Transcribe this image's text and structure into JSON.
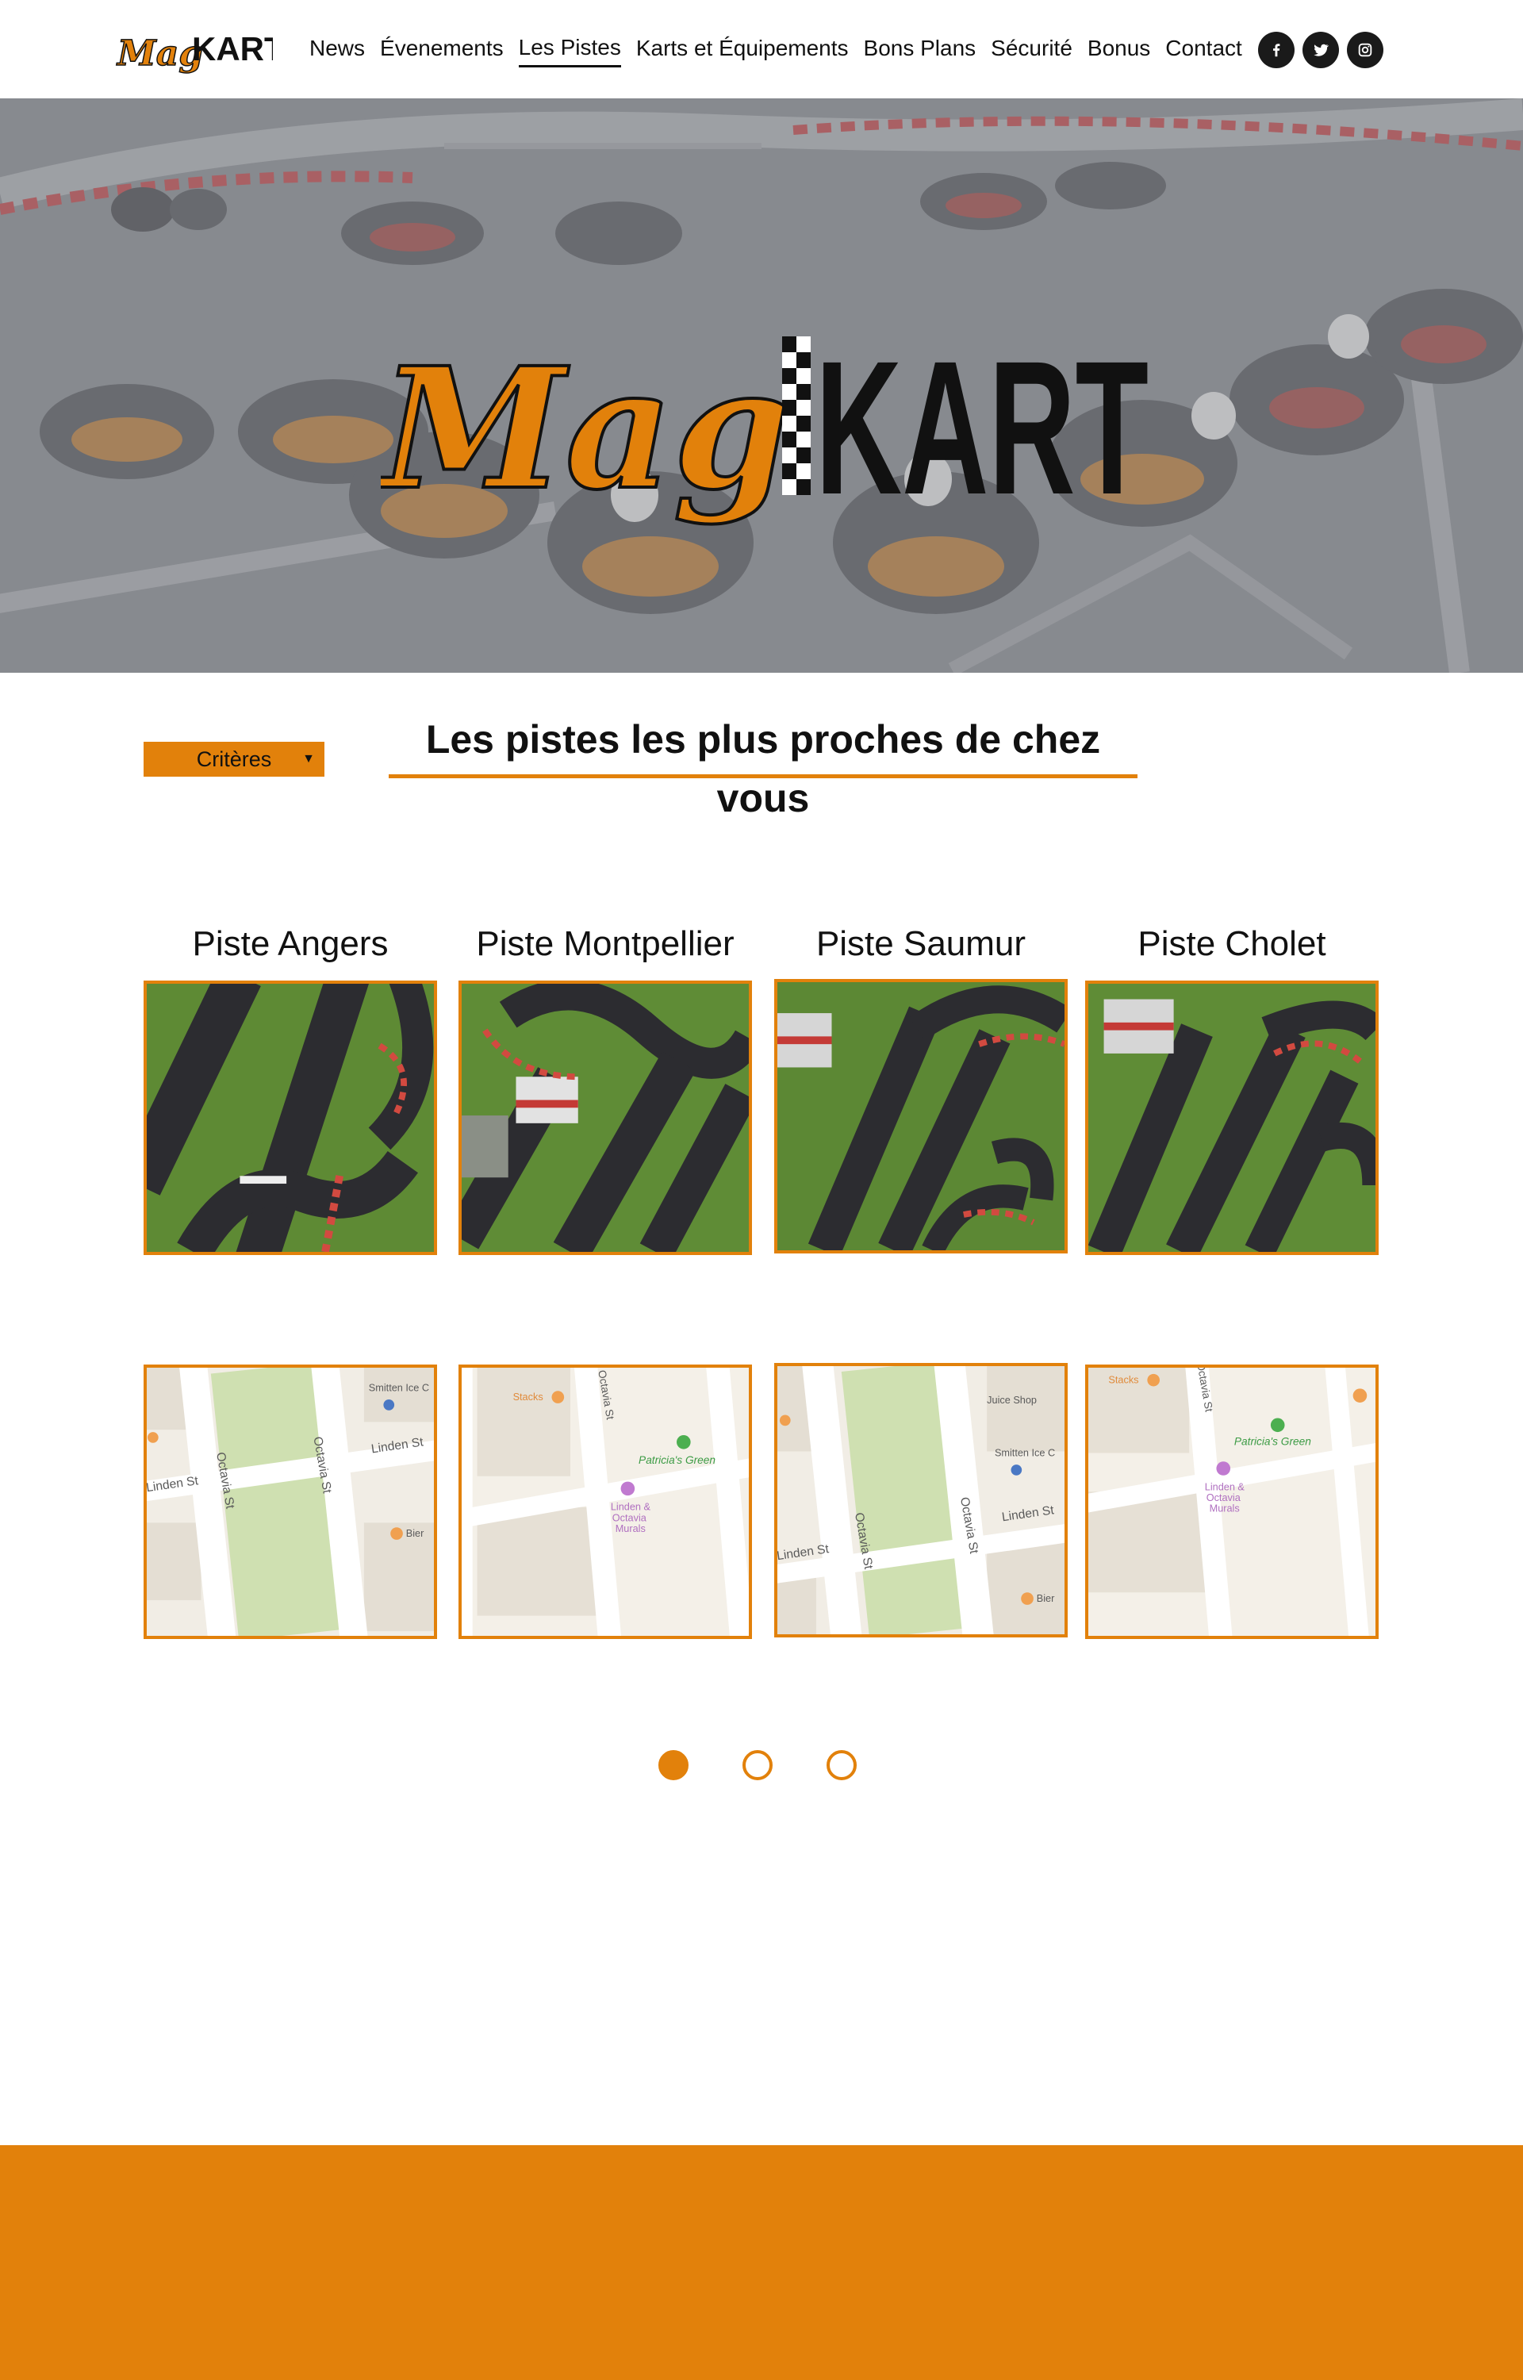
{
  "header": {
    "logo": {
      "mag": "Mag",
      "kart": "KART"
    },
    "nav": [
      {
        "label": "News"
      },
      {
        "label": "Évenements"
      },
      {
        "label": "Les Pistes",
        "active": true
      },
      {
        "label": "Karts et Équipements"
      },
      {
        "label": "Bons Plans"
      },
      {
        "label": "Sécurité"
      },
      {
        "label": "Bonus"
      },
      {
        "label": "Contact"
      }
    ],
    "social": [
      "facebook-icon",
      "twitter-icon",
      "instagram-icon"
    ]
  },
  "hero": {
    "logo": {
      "mag": "Mag",
      "kart": "KART"
    }
  },
  "section": {
    "criteria_label": "Critères",
    "criteria_arrow": "▼",
    "title": "Les pistes les plus proches de chez vous"
  },
  "pistes": [
    {
      "name": "Piste Angers"
    },
    {
      "name": "Piste Montpellier"
    },
    {
      "name": "Piste Saumur"
    },
    {
      "name": "Piste Cholet"
    }
  ],
  "maps": {
    "labels": {
      "octavia": "Octavia St",
      "linden": "Linden St",
      "smitten": "Smitten Ice C",
      "juice": "Juice Shop",
      "stacks": "Stacks",
      "patricia": "Patricia's Green",
      "murals1": "Linden &",
      "murals2": "Octavia",
      "murals3": "Murals",
      "bier": "Bier"
    }
  },
  "pagination": {
    "count": 3,
    "active": 0
  },
  "colors": {
    "accent": "#e2810b",
    "dark": "#111111"
  }
}
